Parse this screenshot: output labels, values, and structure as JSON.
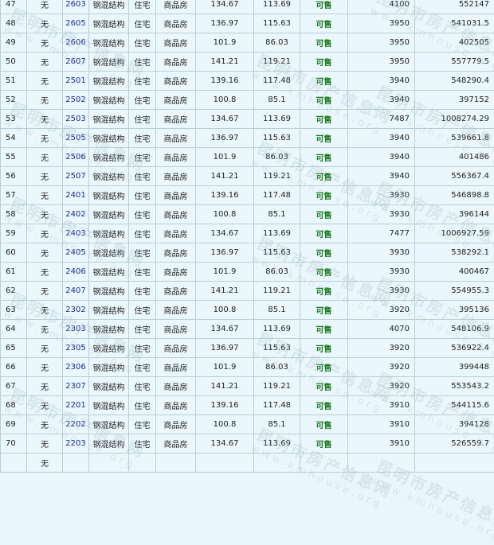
{
  "rows": [
    {
      "no": "47",
      "pre": "无",
      "room": "2603",
      "struct": "钢混结构",
      "use": "住宅",
      "type": "商品房",
      "area": "134.67",
      "inner": "113.69",
      "status": "可售",
      "price": "4100",
      "total": "552147"
    },
    {
      "no": "48",
      "pre": "无",
      "room": "2605",
      "struct": "钢混结构",
      "use": "住宅",
      "type": "商品房",
      "area": "136.97",
      "inner": "115.63",
      "status": "可售",
      "price": "3950",
      "total": "541031.5"
    },
    {
      "no": "49",
      "pre": "无",
      "room": "2606",
      "struct": "钢混结构",
      "use": "住宅",
      "type": "商品房",
      "area": "101.9",
      "inner": "86.03",
      "status": "可售",
      "price": "3950",
      "total": "402505"
    },
    {
      "no": "50",
      "pre": "无",
      "room": "2607",
      "struct": "钢混结构",
      "use": "住宅",
      "type": "商品房",
      "area": "141.21",
      "inner": "119.21",
      "status": "可售",
      "price": "3950",
      "total": "557779.5"
    },
    {
      "no": "51",
      "pre": "无",
      "room": "2501",
      "struct": "钢混结构",
      "use": "住宅",
      "type": "商品房",
      "area": "139.16",
      "inner": "117.48",
      "status": "可售",
      "price": "3940",
      "total": "548290.4"
    },
    {
      "no": "52",
      "pre": "无",
      "room": "2502",
      "struct": "钢混结构",
      "use": "住宅",
      "type": "商品房",
      "area": "100.8",
      "inner": "85.1",
      "status": "可售",
      "price": "3940",
      "total": "397152"
    },
    {
      "no": "53",
      "pre": "无",
      "room": "2503",
      "struct": "钢混结构",
      "use": "住宅",
      "type": "商品房",
      "area": "134.67",
      "inner": "113.69",
      "status": "可售",
      "price": "7487",
      "total": "1008274.29"
    },
    {
      "no": "54",
      "pre": "无",
      "room": "2505",
      "struct": "钢混结构",
      "use": "住宅",
      "type": "商品房",
      "area": "136.97",
      "inner": "115.63",
      "status": "可售",
      "price": "3940",
      "total": "539661.8"
    },
    {
      "no": "55",
      "pre": "无",
      "room": "2506",
      "struct": "钢混结构",
      "use": "住宅",
      "type": "商品房",
      "area": "101.9",
      "inner": "86.03",
      "status": "可售",
      "price": "3940",
      "total": "401486"
    },
    {
      "no": "56",
      "pre": "无",
      "room": "2507",
      "struct": "钢混结构",
      "use": "住宅",
      "type": "商品房",
      "area": "141.21",
      "inner": "119.21",
      "status": "可售",
      "price": "3940",
      "total": "556367.4"
    },
    {
      "no": "57",
      "pre": "无",
      "room": "2401",
      "struct": "钢混结构",
      "use": "住宅",
      "type": "商品房",
      "area": "139.16",
      "inner": "117.48",
      "status": "可售",
      "price": "3930",
      "total": "546898.8"
    },
    {
      "no": "58",
      "pre": "无",
      "room": "2402",
      "struct": "钢混结构",
      "use": "住宅",
      "type": "商品房",
      "area": "100.8",
      "inner": "85.1",
      "status": "可售",
      "price": "3930",
      "total": "396144"
    },
    {
      "no": "59",
      "pre": "无",
      "room": "2403",
      "struct": "钢混结构",
      "use": "住宅",
      "type": "商品房",
      "area": "134.67",
      "inner": "113.69",
      "status": "可售",
      "price": "7477",
      "total": "1006927.59"
    },
    {
      "no": "60",
      "pre": "无",
      "room": "2405",
      "struct": "钢混结构",
      "use": "住宅",
      "type": "商品房",
      "area": "136.97",
      "inner": "115.63",
      "status": "可售",
      "price": "3930",
      "total": "538292.1"
    },
    {
      "no": "61",
      "pre": "无",
      "room": "2406",
      "struct": "钢混结构",
      "use": "住宅",
      "type": "商品房",
      "area": "101.9",
      "inner": "86.03",
      "status": "可售",
      "price": "3930",
      "total": "400467"
    },
    {
      "no": "62",
      "pre": "无",
      "room": "2407",
      "struct": "钢混结构",
      "use": "住宅",
      "type": "商品房",
      "area": "141.21",
      "inner": "119.21",
      "status": "可售",
      "price": "3930",
      "total": "554955.3"
    },
    {
      "no": "63",
      "pre": "无",
      "room": "2302",
      "struct": "钢混结构",
      "use": "住宅",
      "type": "商品房",
      "area": "100.8",
      "inner": "85.1",
      "status": "可售",
      "price": "3920",
      "total": "395136"
    },
    {
      "no": "64",
      "pre": "无",
      "room": "2303",
      "struct": "钢混结构",
      "use": "住宅",
      "type": "商品房",
      "area": "134.67",
      "inner": "113.69",
      "status": "可售",
      "price": "4070",
      "total": "548106.9"
    },
    {
      "no": "65",
      "pre": "无",
      "room": "2305",
      "struct": "钢混结构",
      "use": "住宅",
      "type": "商品房",
      "area": "136.97",
      "inner": "115.63",
      "status": "可售",
      "price": "3920",
      "total": "536922.4"
    },
    {
      "no": "66",
      "pre": "无",
      "room": "2306",
      "struct": "钢混结构",
      "use": "住宅",
      "type": "商品房",
      "area": "101.9",
      "inner": "86.03",
      "status": "可售",
      "price": "3920",
      "total": "399448"
    },
    {
      "no": "67",
      "pre": "无",
      "room": "2307",
      "struct": "钢混结构",
      "use": "住宅",
      "type": "商品房",
      "area": "141.21",
      "inner": "119.21",
      "status": "可售",
      "price": "3920",
      "total": "553543.2"
    },
    {
      "no": "68",
      "pre": "无",
      "room": "2201",
      "struct": "钢混结构",
      "use": "住宅",
      "type": "商品房",
      "area": "139.16",
      "inner": "117.48",
      "status": "可售",
      "price": "3910",
      "total": "544115.6"
    },
    {
      "no": "69",
      "pre": "无",
      "room": "2202",
      "struct": "钢混结构",
      "use": "住宅",
      "type": "商品房",
      "area": "100.8",
      "inner": "85.1",
      "status": "可售",
      "price": "3910",
      "total": "394128"
    },
    {
      "no": "70",
      "pre": "无",
      "room": "2203",
      "struct": "钢混结构",
      "use": "住宅",
      "type": "商品房",
      "area": "134.67",
      "inner": "113.69",
      "status": "可售",
      "price": "3910",
      "total": "526559.7"
    },
    {
      "no": "",
      "pre": "无",
      "room": "",
      "struct": "",
      "use": "",
      "type": "",
      "area": "",
      "inner": "",
      "status": "",
      "price": "",
      "total": ""
    }
  ],
  "watermark": {
    "cn": "昆明市房产信息网",
    "en": "www.kmhouse.org"
  }
}
